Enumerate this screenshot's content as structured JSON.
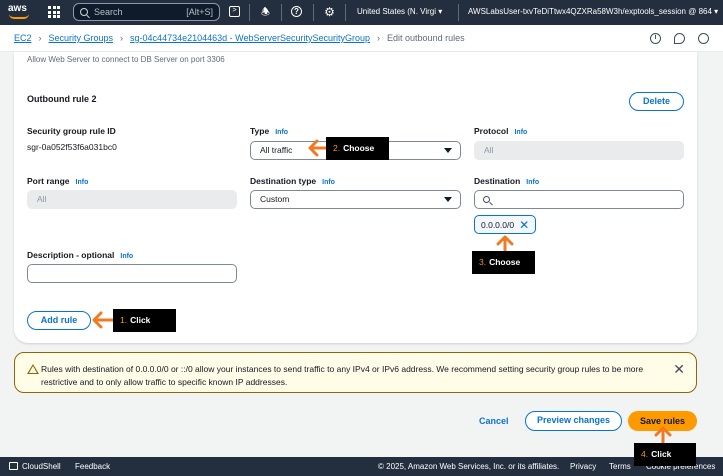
{
  "nav": {
    "logo": "aws",
    "search_placeholder": "Search",
    "search_shortcut": "[Alt+S]",
    "region": "United States (N. Virgi",
    "account": "AWSLabsUser-txvTeDiTtwx4QZXRa58W3h/exptools_session @ 864"
  },
  "breadcrumb": {
    "items": [
      "EC2",
      "Security Groups",
      "sg-04c44734e2104463d - WebServerSecuritySecurityGroup"
    ],
    "current": "Edit outbound rules"
  },
  "form": {
    "helper_text": "Allow Web Server to connect to DB Server on port 3306",
    "rule_title": "Outbound rule 2",
    "delete_label": "Delete",
    "info_label": "Info",
    "sg_rule_id_label": "Security group rule ID",
    "sg_rule_id_value": "sgr-0a052f53f6a031bc0",
    "type_label": "Type",
    "type_value": "All traffic",
    "protocol_label": "Protocol",
    "protocol_value": "All",
    "port_range_label": "Port range",
    "port_range_value": "All",
    "dest_type_label": "Destination type",
    "dest_type_value": "Custom",
    "destination_label": "Destination",
    "destination_token": "0.0.0.0/0",
    "description_label": "Description - optional",
    "description_value": "",
    "add_rule_label": "Add rule"
  },
  "alert": {
    "text": "Rules with destination of 0.0.0.0/0 or ::/0 allow your instances to send traffic to any IPv4 or IPv6 address. We recommend setting security group rules to be more restrictive and to only allow traffic to specific known IP addresses."
  },
  "actions": {
    "cancel": "Cancel",
    "preview": "Preview changes",
    "save": "Save rules"
  },
  "footer": {
    "cloudshell": "CloudShell",
    "feedback": "Feedback",
    "copyright": "© 2025, Amazon Web Services, Inc. or its affiliates.",
    "privacy": "Privacy",
    "terms": "Terms",
    "cookies": "Cookie preferences"
  },
  "annotations": [
    {
      "num": "1.",
      "text": "Click"
    },
    {
      "num": "2.",
      "text": "Choose"
    },
    {
      "num": "3.",
      "text": "Choose"
    },
    {
      "num": "4.",
      "text": "Click"
    }
  ],
  "colors": {
    "accent": "#0972d3",
    "primary_button": "#ff9900",
    "nav_bg": "#232f3e",
    "warning_border": "#8d6605",
    "annotation_arrow": "#f07a21"
  }
}
